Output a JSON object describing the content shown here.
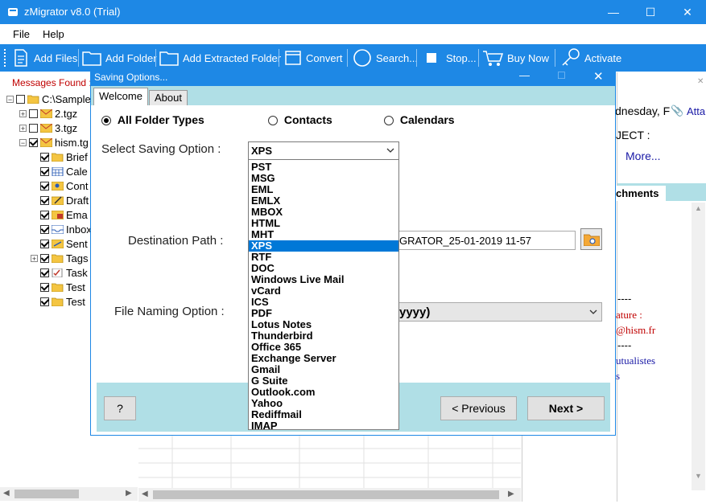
{
  "window": {
    "title": "zMigrator v8.0 (Trial)",
    "minimize": "—",
    "maximize": "☐",
    "close": "✕"
  },
  "menu": [
    "File",
    "Help"
  ],
  "toolbar": {
    "add_files": "Add Files",
    "add_folder": "Add Folder",
    "add_extracted_folder": "Add Extracted Folder",
    "convert": "Convert",
    "search": "Search...",
    "stop": "Stop...",
    "buy_now": "Buy Now",
    "activate": "Activate"
  },
  "left": {
    "messages_found": "Messages Found :",
    "tree": [
      {
        "label": "C:\\Sample",
        "indent": 0,
        "checked": false
      },
      {
        "label": "2.tgz",
        "indent": 1,
        "checked": false
      },
      {
        "label": "3.tgz",
        "indent": 1,
        "checked": false
      },
      {
        "label": "hism.tg",
        "indent": 1,
        "checked": true
      },
      {
        "label": "Brief",
        "indent": 2,
        "checked": true
      },
      {
        "label": "Cale",
        "indent": 2,
        "checked": true
      },
      {
        "label": "Cont",
        "indent": 2,
        "checked": true
      },
      {
        "label": "Draft",
        "indent": 2,
        "checked": true
      },
      {
        "label": "Ema",
        "indent": 2,
        "checked": true
      },
      {
        "label": "Inbox",
        "indent": 2,
        "checked": true
      },
      {
        "label": "Sent",
        "indent": 2,
        "checked": true
      },
      {
        "label": "Tags",
        "indent": 2,
        "checked": true
      },
      {
        "label": "Task",
        "indent": 2,
        "checked": true
      },
      {
        "label": "Test",
        "indent": 2,
        "checked": true
      },
      {
        "label": "Test",
        "indent": 2,
        "checked": true
      }
    ]
  },
  "right": {
    "date_fragment": "dnesday, F",
    "attach": "Atta",
    "subject": "JECT :",
    "more": "More...",
    "attachments_tab": "chments",
    "dashes1": "----",
    "signature": "ature :",
    "email": "@hism.fr",
    "dashes2": "----",
    "mutualistes": "utualistes",
    "s": "s"
  },
  "dialog": {
    "title": "Saving Options...",
    "tabs": [
      "Welcome",
      "About"
    ],
    "radio": {
      "all_folder_types": "All Folder Types",
      "contacts": "Contacts",
      "calendars": "Calendars"
    },
    "select_saving_label": "Select Saving Option :",
    "selected_option": "XPS",
    "destination_label": "Destination Path :",
    "destination_value": "GRATOR_25-01-2019 11-57",
    "naming_label": "File Naming Option :",
    "naming_value": "yyyy)",
    "help_button": "?",
    "previous_button": "< Previous",
    "next_button": "Next >",
    "options": [
      "PST",
      "MSG",
      "EML",
      "EMLX",
      "MBOX",
      "HTML",
      "MHT",
      "XPS",
      "RTF",
      "DOC",
      "Windows Live Mail",
      "vCard",
      "ICS",
      "PDF",
      "Lotus Notes",
      "Thunderbird",
      "Office 365",
      "Exchange Server",
      "Gmail",
      "G Suite",
      "Outlook.com",
      "Yahoo",
      "Rediffmail",
      "IMAP"
    ]
  },
  "colors": {
    "accent": "#1e88e5",
    "dialog_band": "#b0dfe6",
    "selection": "#0078d7",
    "red_text": "#c00000",
    "link_blue": "#1a1aa6"
  }
}
